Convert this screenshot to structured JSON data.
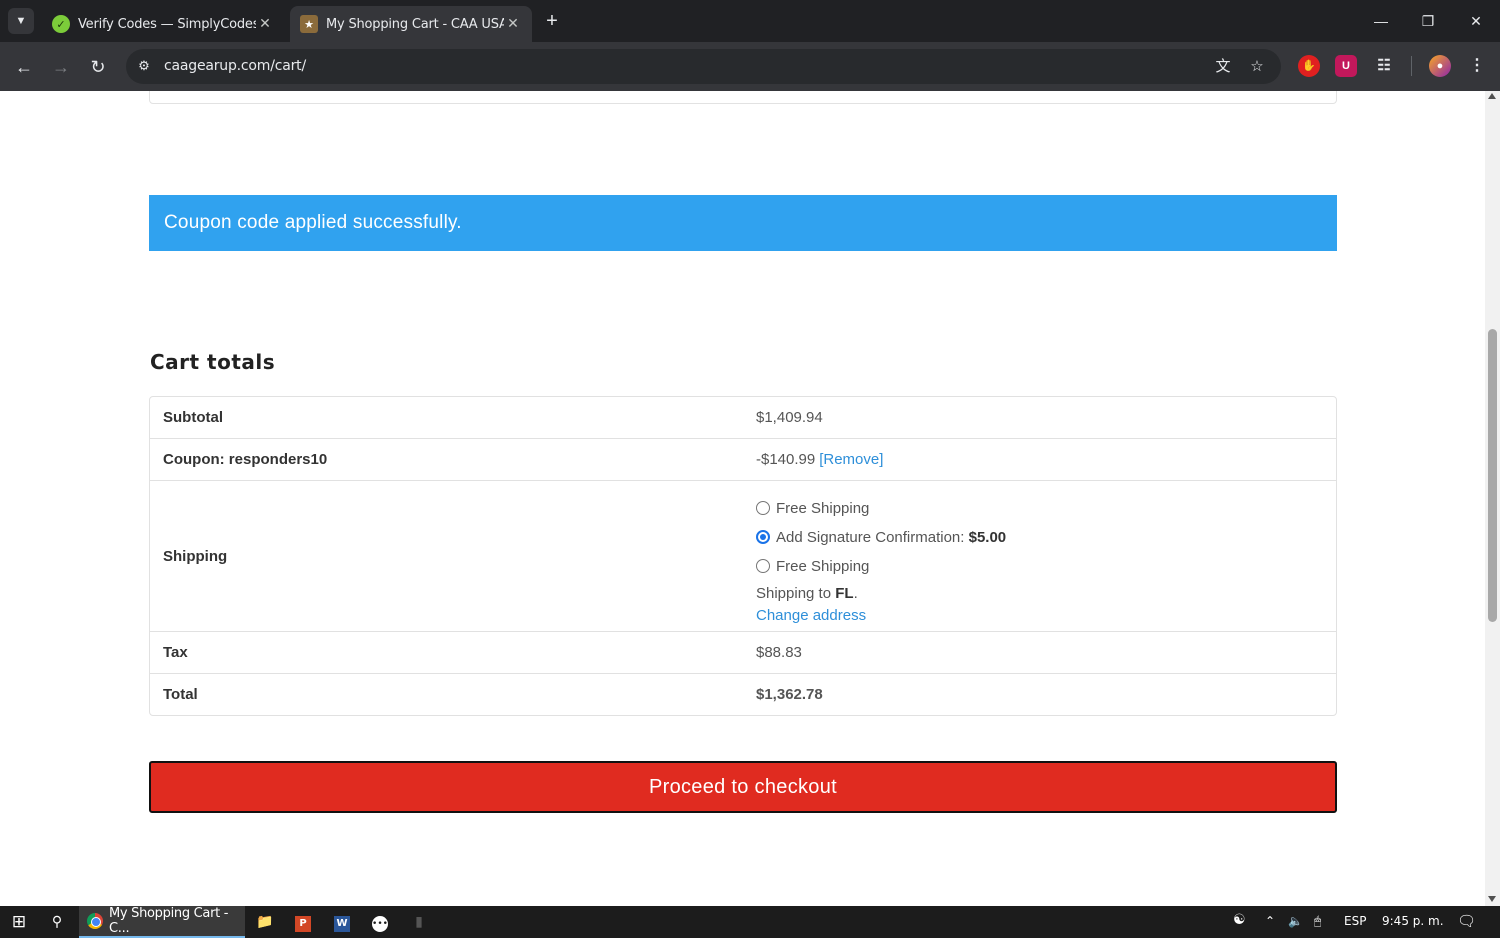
{
  "browser": {
    "tabs": [
      {
        "title": "Verify Codes — SimplyCodes",
        "active": false,
        "favicon": "check-circle-icon"
      },
      {
        "title": "My Shopping Cart - CAA USA",
        "active": true,
        "favicon": "caa-logo-icon"
      }
    ],
    "url": "caagearup.com/cart/"
  },
  "page": {
    "notice": "Coupon code applied successfully.",
    "cart_title": "Cart totals",
    "rows": {
      "subtotal": {
        "label": "Subtotal",
        "value": "$1,409.94"
      },
      "coupon": {
        "label": "Coupon: responders10",
        "value": "-$140.99",
        "remove": "[Remove]"
      },
      "shipping": {
        "label": "Shipping",
        "options": [
          {
            "label": "Free Shipping",
            "price": "",
            "selected": false
          },
          {
            "label": "Add Signature Confirmation:",
            "price": "$5.00",
            "selected": true
          },
          {
            "label": "Free Shipping",
            "price": "",
            "selected": false
          }
        ],
        "ship_to_prefix": "Shipping to",
        "ship_to_state": "FL",
        "ship_to_suffix": ".",
        "change_address": "Change address"
      },
      "tax": {
        "label": "Tax",
        "value": "$88.83"
      },
      "total": {
        "label": "Total",
        "value": "$1,362.78"
      }
    },
    "checkout_button": "Proceed to checkout"
  },
  "taskbar": {
    "app_title": "My Shopping Cart - C...",
    "language": "ESP",
    "time": "9:45 p. m."
  },
  "colors": {
    "notice_bg": "#30a2ef",
    "checkout_bg": "#e02b20",
    "link": "#2e8fd9"
  }
}
